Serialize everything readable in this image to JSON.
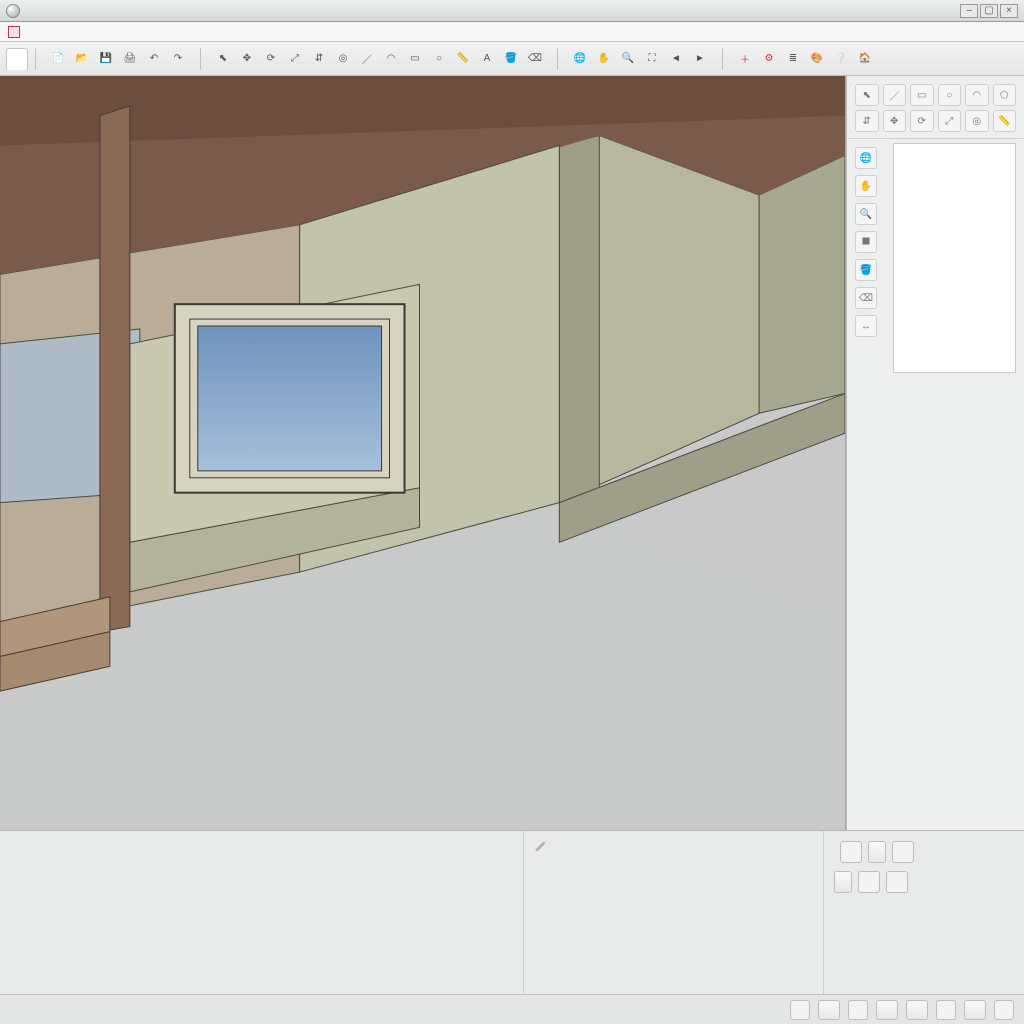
{
  "title": "",
  "pathrow": {
    "text": ""
  },
  "tab": {
    "label": ""
  },
  "toolbar": {
    "group1": [
      "file",
      "open",
      "save",
      "print",
      "undo",
      "redo"
    ],
    "group2": [
      "select",
      "move",
      "rotate",
      "scale",
      "push",
      "offset",
      "line",
      "arc",
      "rect",
      "circle",
      "tape",
      "text",
      "paint",
      "erase"
    ],
    "group3": [
      "orbit",
      "pan",
      "zoom",
      "zoom-ext",
      "prev",
      "next"
    ],
    "group4": [
      "add",
      "settings",
      "layers",
      "styles",
      "help",
      "warehouse"
    ]
  },
  "side": {
    "palette": [
      "select",
      "line",
      "rect",
      "circle",
      "arc",
      "poly",
      "push",
      "move",
      "rotate",
      "scale",
      "offset",
      "tape"
    ],
    "column": [
      "orbit",
      "pan",
      "zoom",
      "section",
      "paint",
      "erase",
      "dims"
    ],
    "panelLabel": ""
  },
  "status": {
    "lines": [
      "",
      "",
      "",
      "",
      ""
    ]
  },
  "hint": {
    "label": "",
    "text": ""
  },
  "dock": {
    "label1": "",
    "btn1": "",
    "btn2": ""
  },
  "footer": {
    "left": "",
    "buttons": [
      "",
      "",
      "",
      ""
    ]
  },
  "viewport": {
    "messages": [
      "",
      ""
    ]
  }
}
